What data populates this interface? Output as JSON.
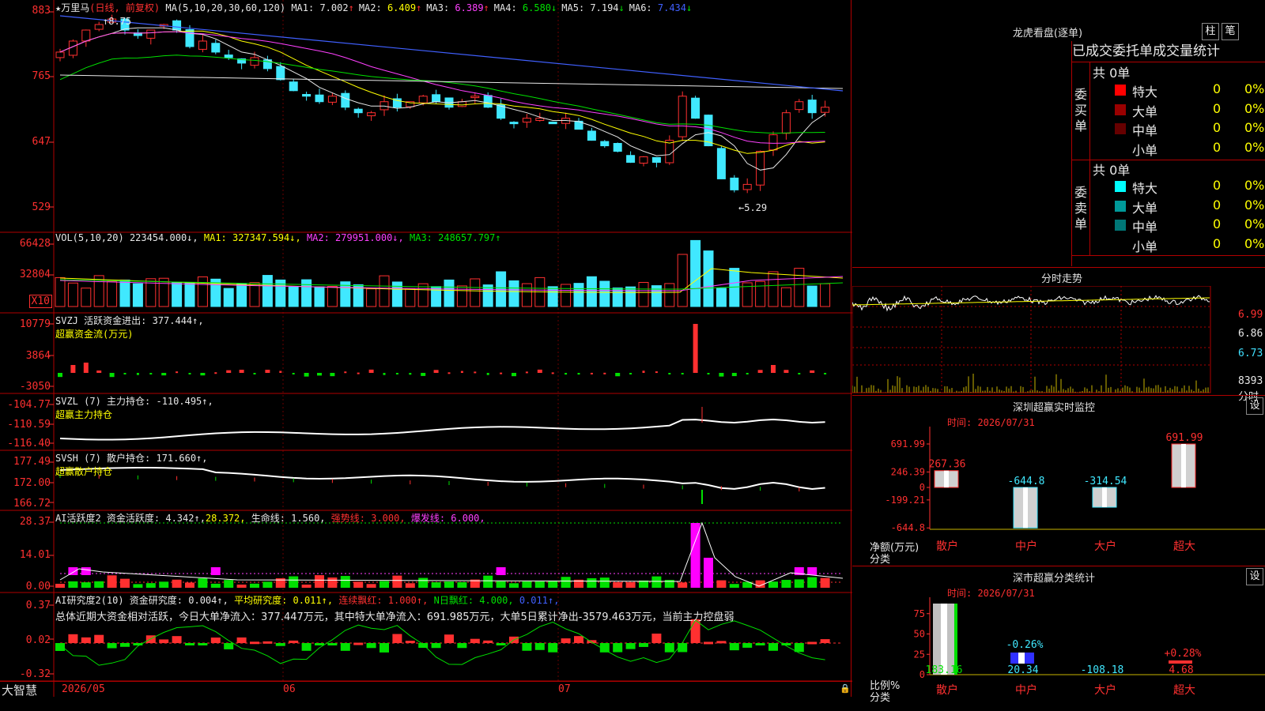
{
  "stock": {
    "name": "★万里马",
    "period": "(日线, 前复权)",
    "ma_label": "MA(5,10,20,30,60,120)",
    "ma_values": [
      {
        "label": "MA1:",
        "value": "7.002",
        "arrow": "↑",
        "color": "#e8e8e8"
      },
      {
        "label": "MA2:",
        "value": "6.409",
        "arrow": "↑",
        "color": "#ffff00"
      },
      {
        "label": "MA3:",
        "value": "6.389",
        "arrow": "↑",
        "color": "#ff40ff"
      },
      {
        "label": "MA4:",
        "value": "6.580",
        "arrow": "↓",
        "color": "#00e000"
      },
      {
        "label": "MA5:",
        "value": "7.194",
        "arrow": "↓",
        "color": "#e8e8e8"
      },
      {
        "label": "MA6:",
        "value": "7.434",
        "arrow": "↓",
        "color": "#4060ff"
      }
    ],
    "high_marker": "8.75",
    "low_marker": "←5.29",
    "price_axis": [
      "883",
      "765",
      "647",
      "529"
    ]
  },
  "vol": {
    "title": "VOL(5,10,20)",
    "value": "223454.000↓,",
    "ma1": "MA1: 327347.594↓,",
    "ma2": "MA2: 279951.000↓,",
    "ma3": "MA3: 248657.797↑",
    "axis": [
      "66428",
      "32804"
    ],
    "unit": "X10"
  },
  "svzj": {
    "title": "SVZJ  活跃资金进出: 377.444↑,",
    "subtitle": "超赢资金流(万元)",
    "axis": [
      "10779",
      "3864",
      "-3050"
    ]
  },
  "svzl": {
    "title": "SVZL (7) 主力持仓: -110.495↑,",
    "subtitle": "超赢主力持仓",
    "axis": [
      "-104.77",
      "-110.59",
      "-116.40"
    ]
  },
  "svsh": {
    "title": "SVSH (7) 散户持仓: 171.660↑,",
    "subtitle": "超赢散户持仓",
    "axis": [
      "177.49",
      "172.00",
      "166.72"
    ]
  },
  "ai_active": {
    "title": "AI活跃度2 资金活跃度: 4.342↑,",
    "v2": "28.372,",
    "v3": "生命线: 1.560,",
    "v4": "强势线: 3.000,",
    "v5": "爆发线: 6.000,",
    "axis": [
      "28.37",
      "14.01",
      "0.00"
    ]
  },
  "ai_research": {
    "title": "AI研究度2(10) 资金研究度: 0.004↑,",
    "v2": "平均研究度: 0.011↑,",
    "v3": "连续飘红: 1.000↑,",
    "v4": "N日飘红: 4.000,",
    "v5": "0.011↑,",
    "summary": "总体近期大资金相对活跃，今日大单净流入：377.447万元，其中特大单净流入：691.985万元，大单5日累计净出-3579.463万元，当前主力控盘弱",
    "axis": [
      "0.37",
      "0.02",
      "-0.32"
    ]
  },
  "bottom": {
    "brand": "大智慧",
    "dates": [
      "2026/05",
      "06",
      "07"
    ]
  },
  "dragon_tiger": {
    "title": "龙虎看盘(逐单)",
    "btn_a": "柱",
    "btn_b": "笔",
    "tabs": "已成交委托单成交量统计",
    "buy_label": "委买单",
    "sell_label": "委卖单",
    "buy_total": "共 0单",
    "sell_total": "共 0单",
    "buy_rows": [
      {
        "name": "特大",
        "v": "0",
        "p": "0%",
        "color": "#ff0000"
      },
      {
        "name": "大单",
        "v": "0",
        "p": "0%",
        "color": "#990000"
      },
      {
        "name": "中单",
        "v": "0",
        "p": "0%",
        "color": "#660000"
      },
      {
        "name": "小单",
        "v": "0",
        "p": "0%",
        "color": "#000000"
      }
    ],
    "sell_rows": [
      {
        "name": "特大",
        "v": "0",
        "p": "0%",
        "color": "#00ffff"
      },
      {
        "name": "大单",
        "v": "0",
        "p": "0%",
        "color": "#009999"
      },
      {
        "name": "中单",
        "v": "0",
        "p": "0%",
        "color": "#007777"
      },
      {
        "name": "小单",
        "v": "0",
        "p": "0%",
        "color": "#000000"
      }
    ]
  },
  "intraday": {
    "title": "分时走势",
    "axis": [
      "6.99",
      "6.86",
      "6.73"
    ],
    "vol_label": "8393",
    "vol_unit": "分时"
  },
  "sz_monitor": {
    "title": "深圳超赢实时监控",
    "btn": "设",
    "time": "时间: 2026/07/31",
    "axis": [
      "691.99",
      "246.39",
      "0",
      "-199.21",
      "-644.8"
    ],
    "ylabel1": "净额(万元)",
    "ylabel2": "分类",
    "categories": [
      "散户",
      "中户",
      "大户",
      "超大"
    ],
    "values": [
      267.36,
      -644.8,
      -314.54,
      691.99
    ],
    "value_labels": [
      "267.36",
      "-644.8",
      "-314.54",
      "691.99"
    ]
  },
  "sz_class": {
    "title": "深市超赢分类统计",
    "btn": "设",
    "time": "时间: 2026/07/31",
    "axis": [
      "75",
      "50",
      "25",
      "0"
    ],
    "ylabel1": "比例%",
    "ylabel2": "分类",
    "categories": [
      "散户",
      "中户",
      "大户",
      "超大"
    ],
    "pct_labels": [
      "",
      "-0.26%",
      "",
      "+0.28%"
    ],
    "bottom_values": [
      "183.16",
      "20.34",
      "-108.18",
      "4.68"
    ]
  },
  "colors": {
    "up": "#ff3030",
    "down": "#40e8ff",
    "grid": "#b00000"
  }
}
